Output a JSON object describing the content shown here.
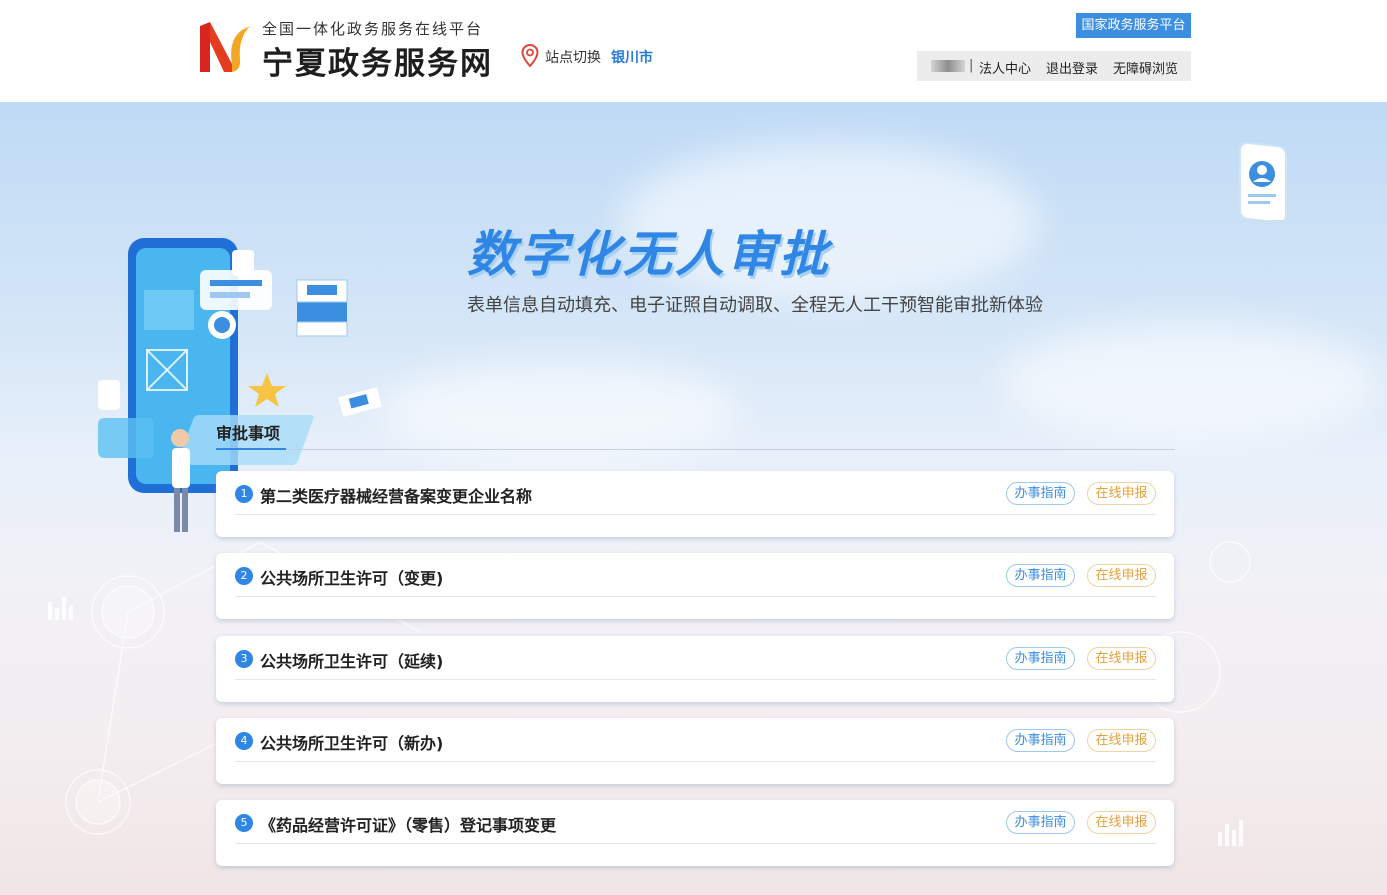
{
  "header": {
    "logo_sub": "全国一体化政务服务在线平台",
    "logo_main": "宁夏政务服务网",
    "site_switch": "站点切换",
    "city": "银川市",
    "national_platform": "国家政务服务平台",
    "user_bar": {
      "separator": "|",
      "legal_center": "法人中心",
      "logout": "退出登录",
      "accessibility": "无障碍浏览"
    }
  },
  "banner": {
    "title": "数字化无人审批",
    "subtitle": "表单信息自动填充、电子证照自动调取、全程无人工干预智能审批新体验"
  },
  "section": {
    "title": "审批事项"
  },
  "items": [
    {
      "num": "1",
      "name": "第二类医疗器械经营备案变更企业名称",
      "guide": "办事指南",
      "apply": "在线申报"
    },
    {
      "num": "2",
      "name": "公共场所卫生许可（变更)",
      "guide": "办事指南",
      "apply": "在线申报"
    },
    {
      "num": "3",
      "name": "公共场所卫生许可（延续)",
      "guide": "办事指南",
      "apply": "在线申报"
    },
    {
      "num": "4",
      "name": "公共场所卫生许可（新办)",
      "guide": "办事指南",
      "apply": "在线申报"
    },
    {
      "num": "5",
      "name": "《药品经营许可证》（零售）登记事项变更",
      "guide": "办事指南",
      "apply": "在线申报"
    }
  ],
  "colors": {
    "accent": "#2f86e4",
    "guide_border": "#9ec8ef",
    "apply_text": "#e8a03b",
    "logo_red": "#d7261e",
    "logo_orange": "#f2a623"
  }
}
